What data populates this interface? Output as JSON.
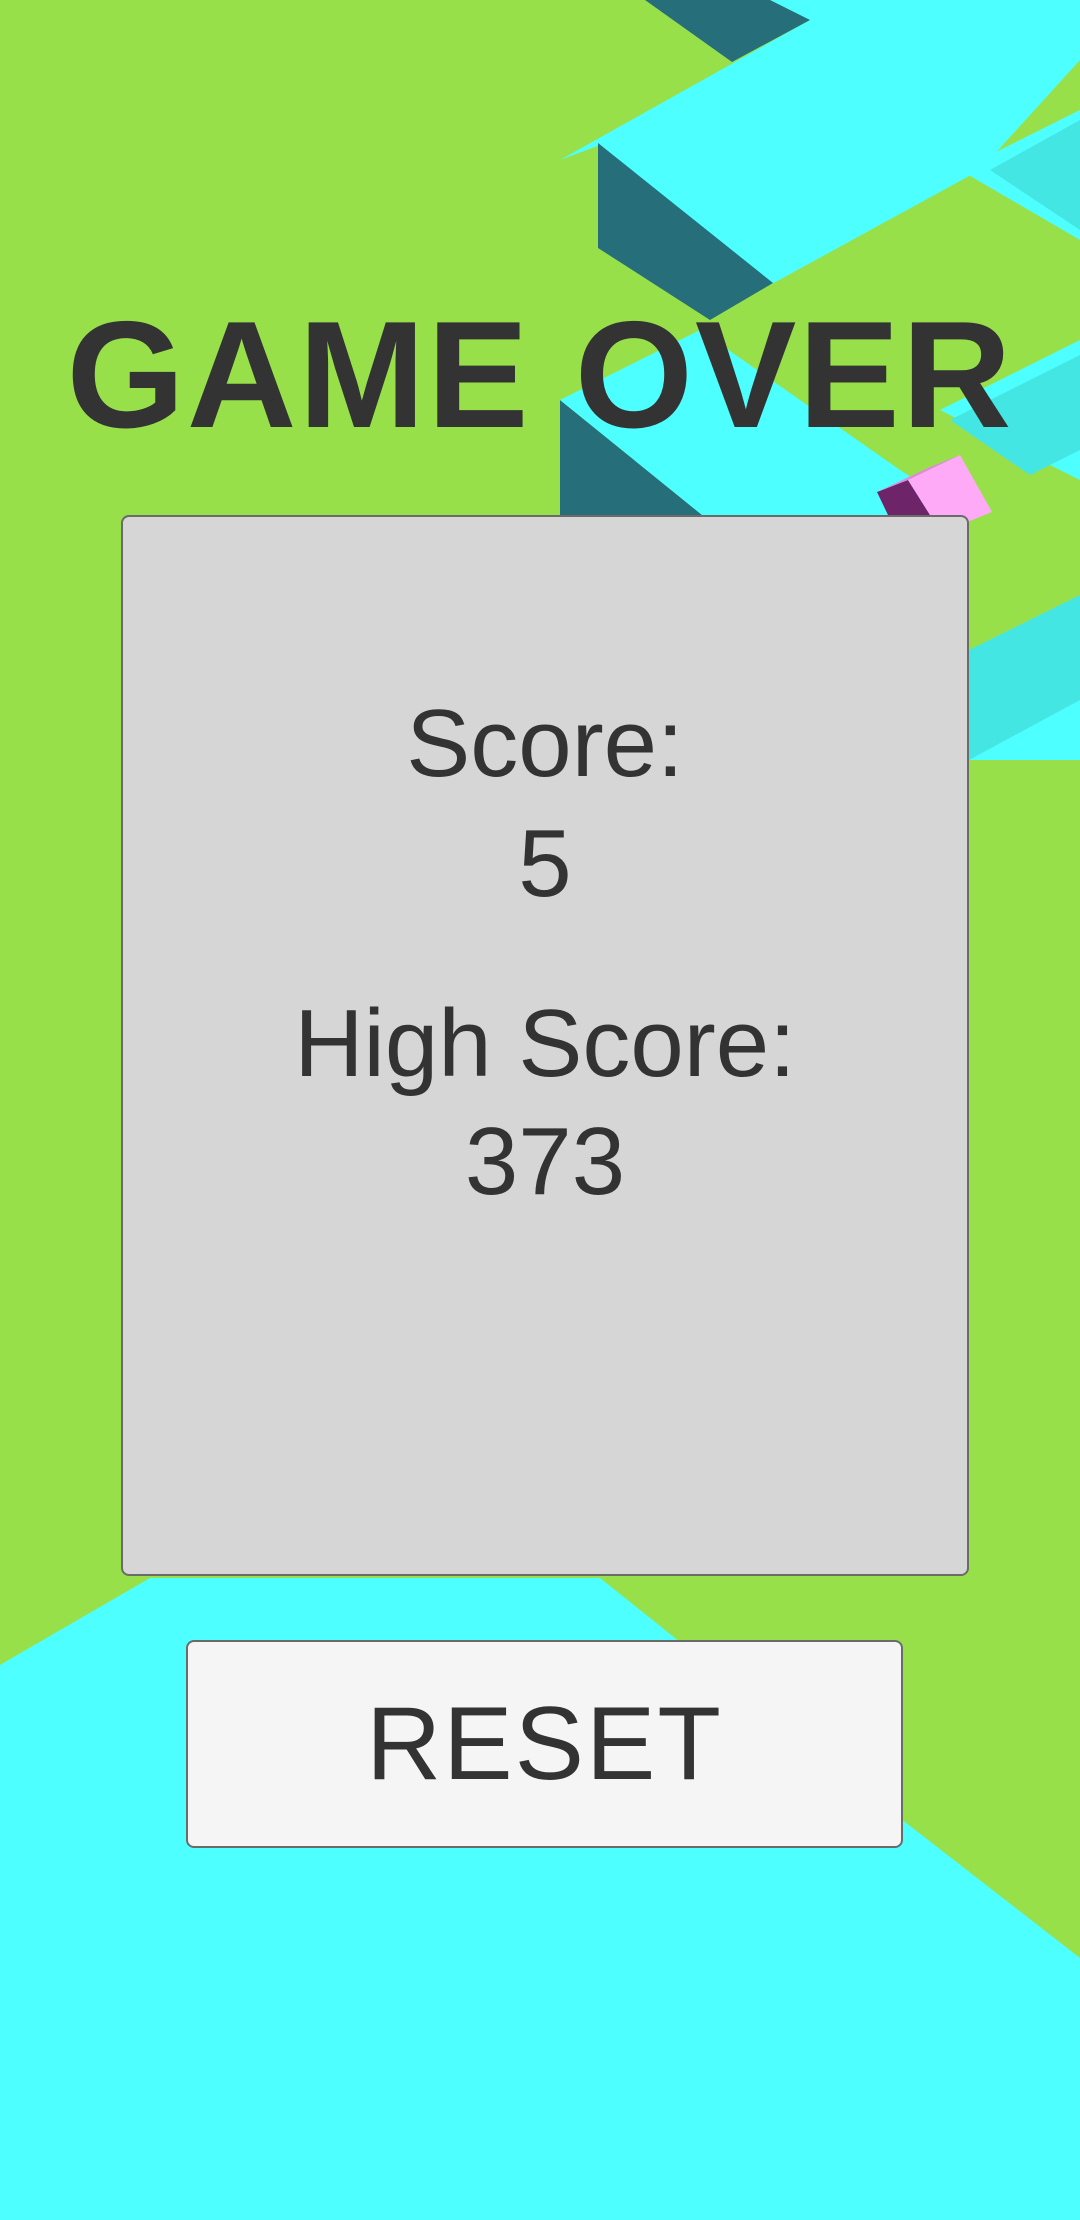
{
  "title": "GAME OVER",
  "score": {
    "label": "Score:",
    "value": "5"
  },
  "high_score": {
    "label": "High Score:",
    "value": "373"
  },
  "reset_button": {
    "label": "RESET"
  },
  "colors": {
    "background_green": "#98e04a",
    "path_cyan": "#4dfffe",
    "path_shadow": "#266e7a",
    "path_side": "#44e6e4",
    "ball_pink": "#ffaaf7",
    "ball_dark": "#6d2468",
    "panel": "#d6d6d6",
    "button": "#f4f5f4",
    "text": "#333333"
  }
}
